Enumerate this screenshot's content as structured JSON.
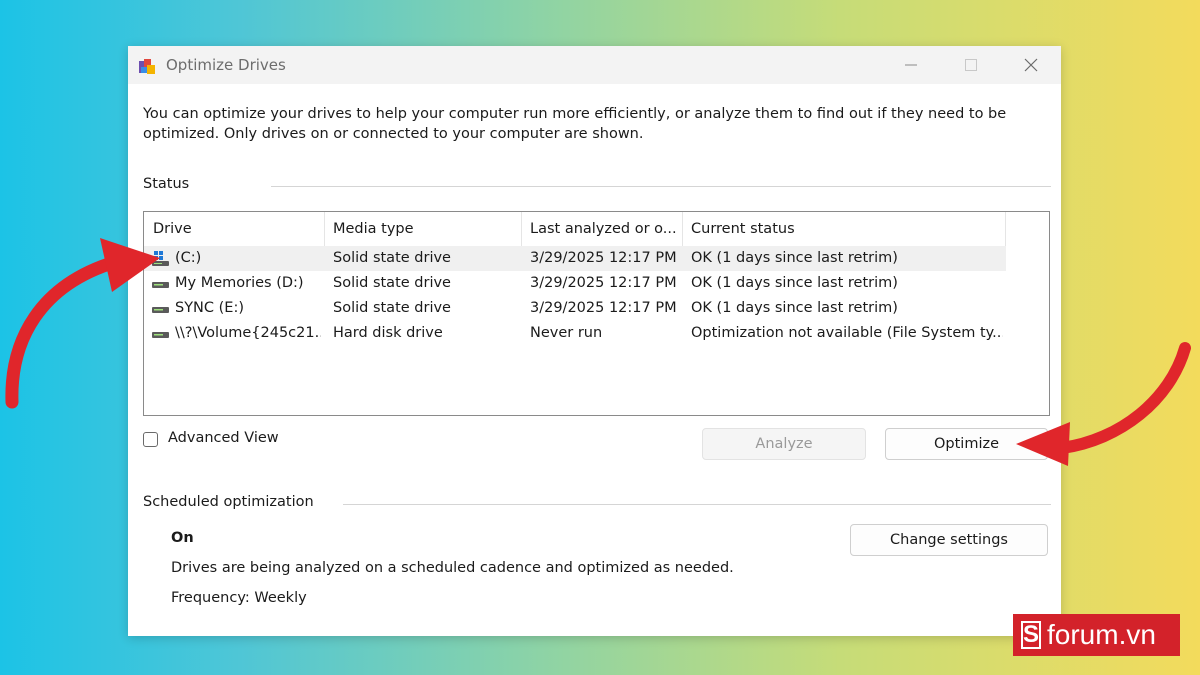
{
  "window": {
    "title": "Optimize Drives",
    "description": "You can optimize your drives to help your computer run more efficiently, or analyze them to find out if they need to be optimized. Only drives on or connected to your computer are shown."
  },
  "status": {
    "label": "Status",
    "columns": [
      "Drive",
      "Media type",
      "Last analyzed or o...",
      "Current status"
    ],
    "drives": [
      {
        "name": "(C:)",
        "media": "Solid state drive",
        "last": "3/29/2025 12:17 PM",
        "status": "OK (1 days since last retrim)",
        "icon": "windows-drive-icon",
        "selected": true
      },
      {
        "name": "My Memories (D:)",
        "media": "Solid state drive",
        "last": "3/29/2025 12:17 PM",
        "status": "OK (1 days since last retrim)",
        "icon": "drive-icon",
        "selected": false
      },
      {
        "name": "SYNC (E:)",
        "media": "Solid state drive",
        "last": "3/29/2025 12:17 PM",
        "status": "OK (1 days since last retrim)",
        "icon": "drive-icon",
        "selected": false
      },
      {
        "name": "\\\\?\\Volume{245c21...",
        "media": "Hard disk drive",
        "last": "Never run",
        "status": "Optimization not available (File System ty...",
        "icon": "drive-icon",
        "selected": false
      }
    ]
  },
  "controls": {
    "advanced_view": "Advanced View",
    "analyze": "Analyze",
    "optimize": "Optimize"
  },
  "schedule": {
    "label": "Scheduled optimization",
    "state": "On",
    "description": "Drives are being analyzed on a scheduled cadence and optimized as needed.",
    "frequency": "Frequency: Weekly",
    "change_settings": "Change settings"
  },
  "watermark": {
    "text": "forum.vn",
    "letter": "S"
  },
  "colors": {
    "arrow": "#e0262b",
    "logo_bg": "#d3222a"
  }
}
